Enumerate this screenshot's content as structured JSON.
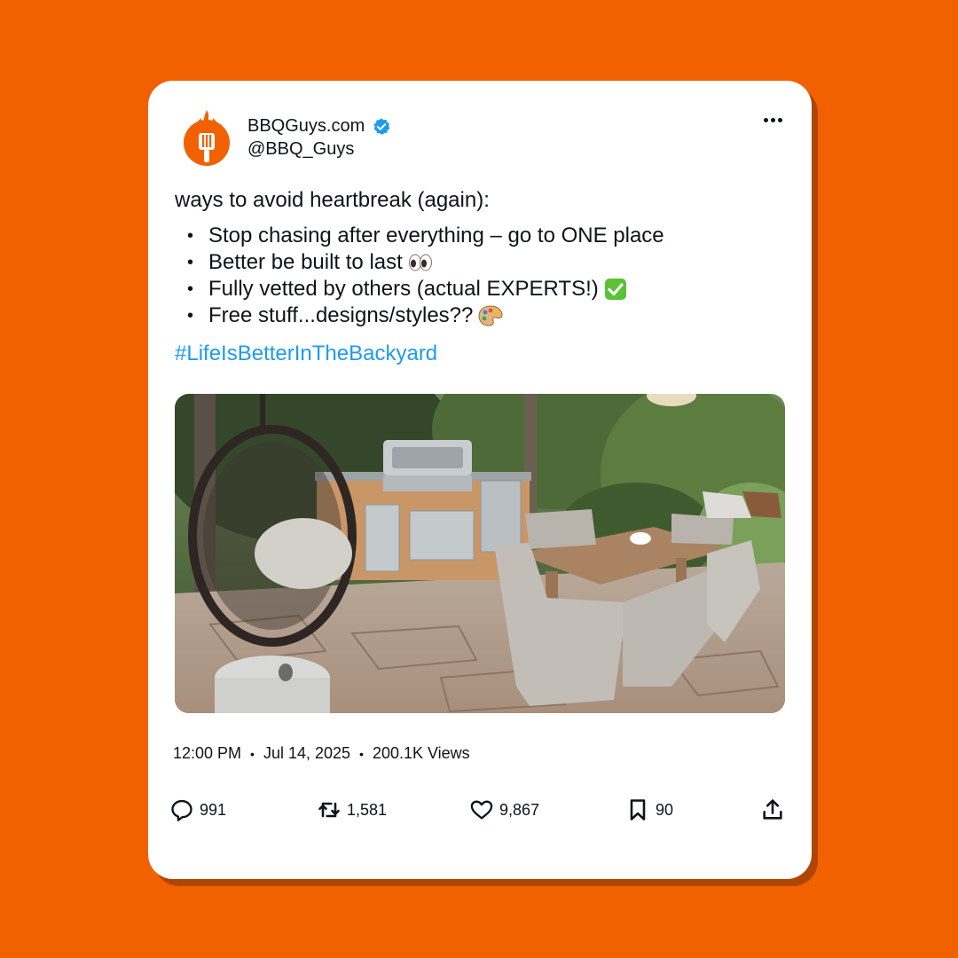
{
  "account": {
    "display_name": "BBQGuys.com",
    "handle": "@BBQ_Guys",
    "verified": true,
    "avatar_icon": "flame-spatula-logo"
  },
  "post": {
    "intro": "ways to avoid heartbreak (again):",
    "bullets": [
      {
        "text": "Stop chasing after everything – go to ONE place",
        "emoji": ""
      },
      {
        "text": "Better be built to last",
        "emoji": "eyes"
      },
      {
        "text": "Fully vetted by others (actual EXPERTS!)",
        "emoji": "check-mark-button"
      },
      {
        "text": "Free stuff...designs/styles??",
        "emoji": "artist-palette"
      }
    ],
    "hashtag": "#LifeIsBetterInTheBackyard"
  },
  "meta": {
    "time": "12:00 PM",
    "date": "Jul 14, 2025",
    "views": "200.1K Views"
  },
  "actions": {
    "replies": "991",
    "reposts": "1,581",
    "likes": "9,867",
    "bookmarks": "90"
  },
  "colors": {
    "background": "#F26100",
    "brand_orange": "#F26100",
    "hashtag_blue": "#1D9BF0",
    "verified_blue": "#1D9BF0",
    "check_green": "#5BC236"
  }
}
